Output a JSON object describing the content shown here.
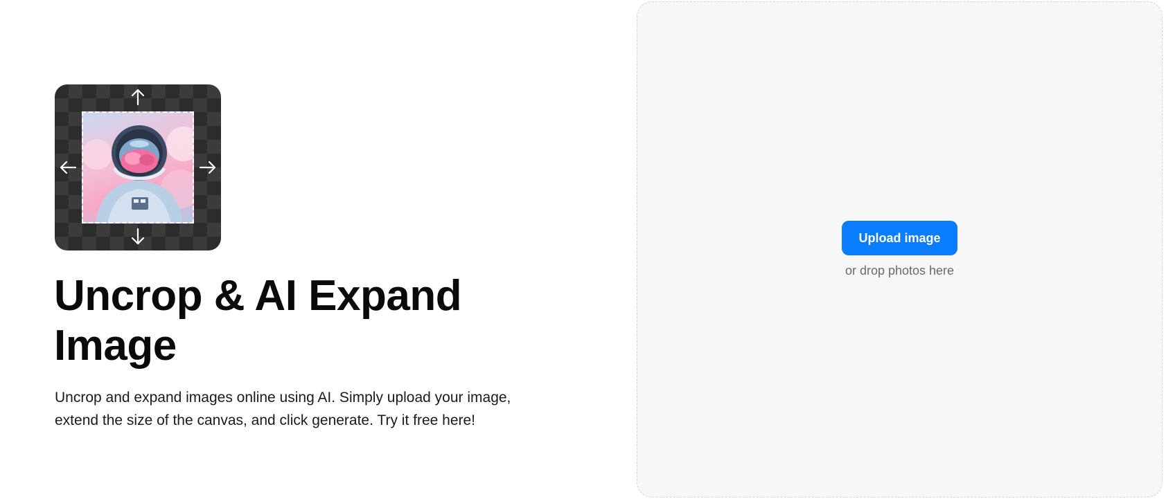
{
  "hero": {
    "image_description_icon": "astronaut-photo-with-expand-arrows",
    "arrow_icons": [
      "arrow-up-icon",
      "arrow-down-icon",
      "arrow-left-icon",
      "arrow-right-icon"
    ]
  },
  "title": "Uncrop & AI Expand Image",
  "description": "Uncrop and expand images online using AI. Simply upload your image, extend the size of the canvas, and click generate. Try it free here!",
  "upload": {
    "button_label": "Upload image",
    "drop_hint": "or drop photos here"
  },
  "colors": {
    "accent": "#0a7cff",
    "panel_background": "#f7f7f7"
  }
}
